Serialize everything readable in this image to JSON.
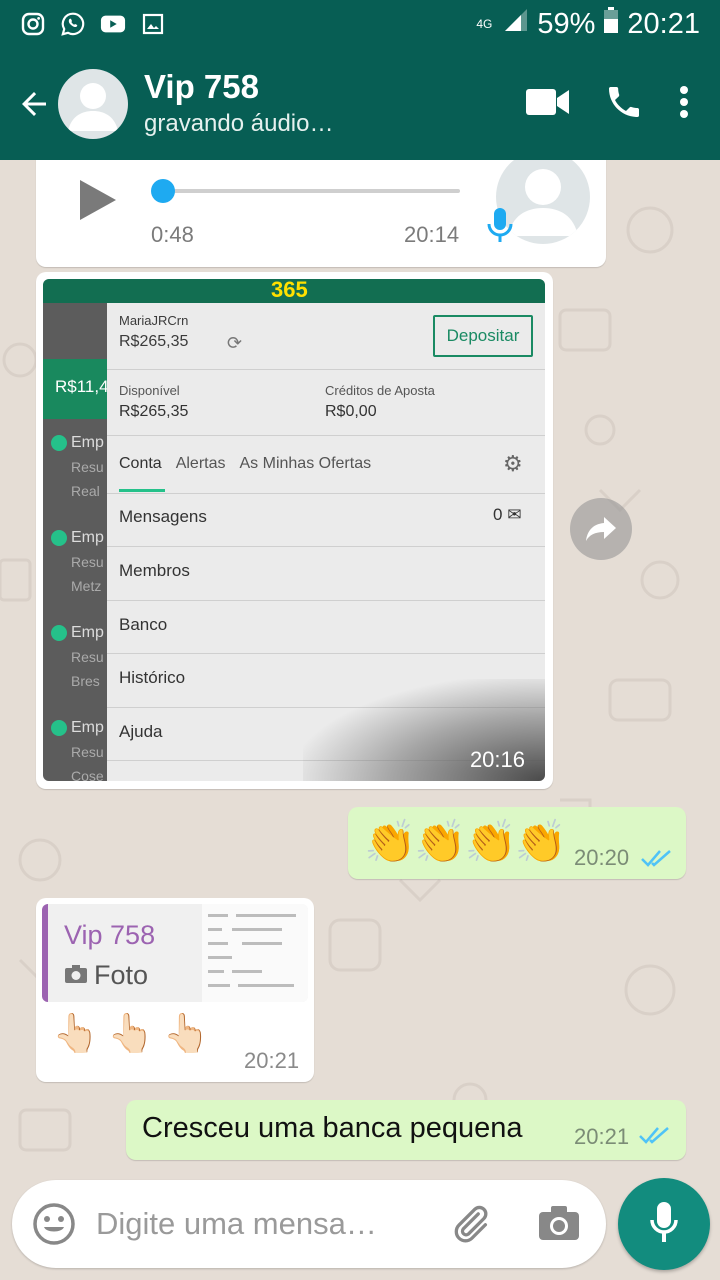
{
  "status_bar": {
    "network": "4G",
    "battery": "59%",
    "time": "20:21",
    "icons": [
      "instagram-icon",
      "whatsapp-icon",
      "youtube-icon",
      "gallery-icon",
      "signal-icon",
      "battery-icon"
    ]
  },
  "header": {
    "contact_name": "Vip 758",
    "status": "gravando áudio…",
    "icons": [
      "back-arrow-icon",
      "video-call-icon",
      "phone-icon",
      "more-vert-icon"
    ]
  },
  "messages": {
    "audio": {
      "duration": "0:48",
      "time": "20:14",
      "progress": 0
    },
    "image": {
      "time": "20:16",
      "screenshot": {
        "brand": "365",
        "left_balance": "R$11,4",
        "left_items": [
          "Emp",
          "Resu",
          "Real",
          "Emp",
          "Resu",
          "Metz",
          "Emp",
          "Resu",
          "Bres",
          "Emp",
          "Resu",
          "Cose"
        ],
        "username": "MariaJRCrn",
        "balance": "R$265,35",
        "deposit_button": "Depositar",
        "available_label": "Disponível",
        "available_value": "R$265,35",
        "credits_label": "Créditos de Aposta",
        "credits_value": "R$0,00",
        "tabs": [
          "Conta",
          "Alertas",
          "As Minhas Ofertas"
        ],
        "rows": [
          "Mensagens",
          "Membros",
          "Banco",
          "Histórico",
          "Ajuda"
        ],
        "message_count": "0"
      }
    },
    "claps": {
      "emoji": "👏👏👏👏",
      "time": "20:20"
    },
    "reply": {
      "quoted_name": "Vip 758",
      "quoted_text": "Foto",
      "body": "👆🏻👆🏻👆🏻",
      "time": "20:21"
    },
    "text": {
      "body": "Cresceu uma banca pequena",
      "time": "20:21"
    }
  },
  "composer": {
    "placeholder": "Digite uma mensa…"
  },
  "colors": {
    "header": "#075e54",
    "outgoing": "#dcf8c6",
    "incoming": "#ffffff",
    "read_ticks": "#4fc3f7",
    "mic_button": "#128c7e"
  }
}
